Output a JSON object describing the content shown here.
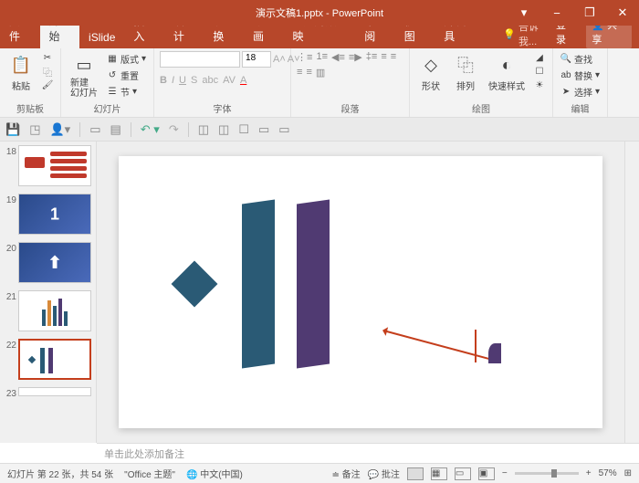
{
  "app": {
    "name": "PowerPoint",
    "filename": "演示文稿1.pptx"
  },
  "win": {
    "min": "−",
    "max": "❐",
    "close": "✕",
    "restore": "▾"
  },
  "tabs": {
    "file": "文件",
    "home": "开始",
    "islide": "iSlide",
    "insert": "插入",
    "design": "设计",
    "transition": "切换",
    "animation": "动画",
    "slideshow": "幻灯片放映",
    "review": "审阅",
    "view": "视图",
    "dev": "开发工具",
    "tellme": "告诉我...",
    "login": "登录",
    "share": "共享"
  },
  "ribbon": {
    "clipboard": {
      "label": "剪贴板",
      "paste": "粘贴"
    },
    "slides": {
      "label": "幻灯片",
      "new": "新建\n幻灯片",
      "layout": "版式",
      "reset": "重置",
      "section": "节"
    },
    "font": {
      "label": "字体",
      "size": "18"
    },
    "para": {
      "label": "段落"
    },
    "drawing": {
      "label": "绘图",
      "shapes": "形状",
      "arrange": "排列",
      "styles": "快速样式"
    },
    "editing": {
      "label": "编辑",
      "find": "查找",
      "replace": "替换",
      "select": "选择"
    }
  },
  "thumbs": [
    {
      "num": "18"
    },
    {
      "num": "19"
    },
    {
      "num": "20"
    },
    {
      "num": "21"
    },
    {
      "num": "22"
    },
    {
      "num": "23"
    }
  ],
  "notes_placeholder": "单击此处添加备注",
  "status": {
    "slide_info": "幻灯片 第 22 张，共 54 张",
    "theme": "\"Office 主题\"",
    "lang": "中文(中国)",
    "notes": "备注",
    "comments": "批注",
    "zoom": "57%"
  },
  "chart_data": {
    "type": "other",
    "note": "PowerPoint slide with abstract decorative shapes (diamond, two skewed bars, arrow annotation). No quantitative chart data present."
  }
}
